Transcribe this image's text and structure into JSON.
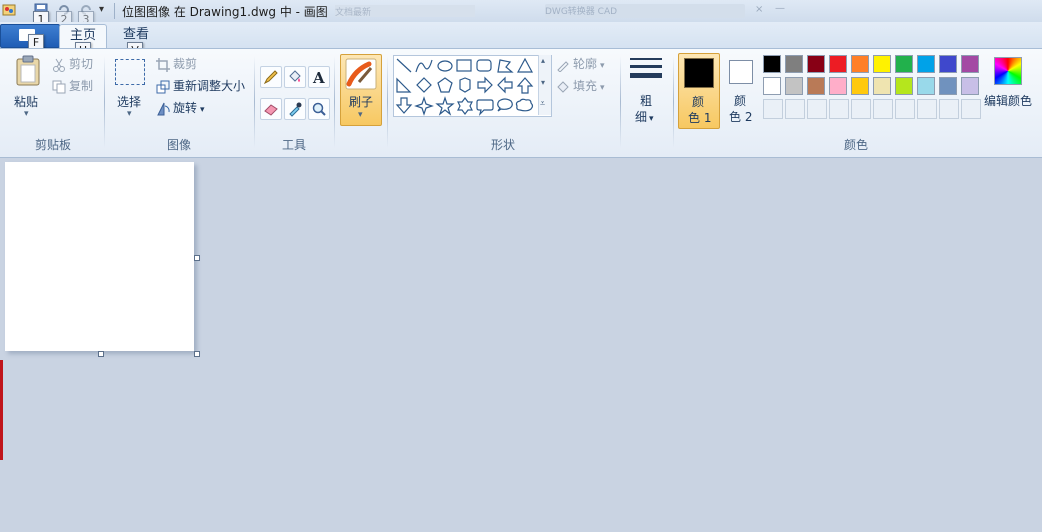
{
  "window": {
    "title": "位图图像 在 Drawing1.dwg 中 - 画图",
    "background_task_text": "文档最新",
    "background_tab_text": "DWG转换器 CAD"
  },
  "quick_access": {
    "keytips": [
      "1",
      "2",
      "3"
    ]
  },
  "tabs": {
    "app_keytip": "F",
    "home": "主页",
    "home_keytip": "H",
    "view": "查看",
    "view_keytip": "V"
  },
  "clipboard": {
    "paste": "粘贴",
    "cut": "剪切",
    "copy": "复制",
    "group": "剪贴板"
  },
  "image": {
    "select": "选择",
    "crop": "裁剪",
    "resize": "重新调整大小",
    "rotate": "旋转",
    "group": "图像"
  },
  "tools": {
    "group": "工具",
    "icons": [
      "pencil-icon",
      "fill-bucket-icon",
      "text-icon",
      "eraser-icon",
      "color-picker-icon",
      "magnifier-icon"
    ]
  },
  "brushes": {
    "label": "刷子"
  },
  "shapes": {
    "group": "形状",
    "outline": "轮廓",
    "fill": "填充"
  },
  "size": {
    "label_line1": "粗",
    "label_line2": "细"
  },
  "colors": {
    "color1_line1": "颜",
    "color1_line2": "色 1",
    "color2_line1": "颜",
    "color2_line2": "色 2",
    "edit": "编辑颜色",
    "group": "颜色",
    "row1": [
      "#000000",
      "#7f7f7f",
      "#880015",
      "#ed1c24",
      "#ff7f27",
      "#fff200",
      "#22b14c",
      "#00a2e8",
      "#3f48cc",
      "#a349a4"
    ],
    "row2": [
      "#ffffff",
      "#c3c3c3",
      "#b97a57",
      "#ffaec9",
      "#ffc90e",
      "#efe4b0",
      "#b5e61d",
      "#99d9ea",
      "#7092be",
      "#c8bfe7"
    ],
    "color1": "#000000",
    "color2": "#ffffff"
  }
}
